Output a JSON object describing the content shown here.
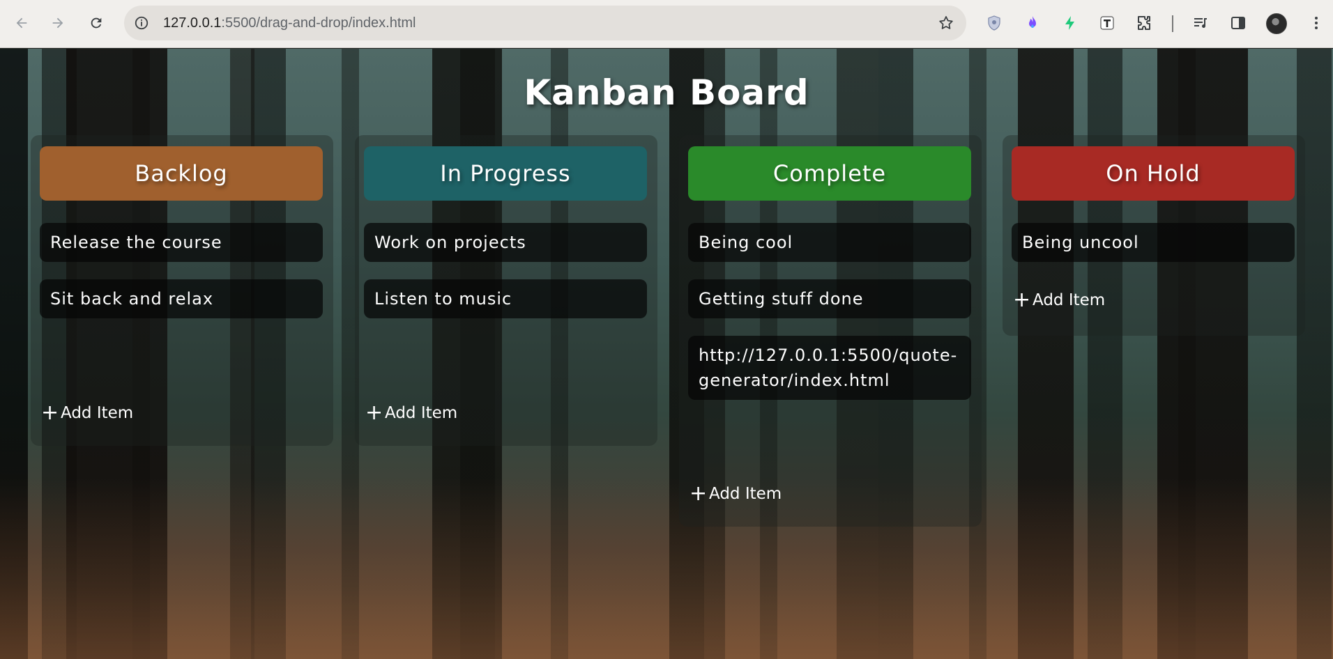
{
  "browser": {
    "url_host": "127.0.0.1",
    "url_rest": ":5500/drag-and-drop/index.html",
    "extensions": [
      "shield-extension-icon",
      "flame-extension-icon",
      "bolt-extension-icon",
      "text-extension-icon",
      "puzzle-extensions-icon",
      "media-control-icon",
      "side-panel-icon"
    ]
  },
  "board": {
    "title": "Kanban Board",
    "add_item_label": "Add Item",
    "columns": [
      {
        "title": "Backlog",
        "color": "#a0602e",
        "items": [
          "Release the course",
          "Sit back and relax"
        ]
      },
      {
        "title": "In Progress",
        "color": "#1e6266",
        "items": [
          "Work on projects",
          "Listen to music"
        ]
      },
      {
        "title": "Complete",
        "color": "#2a8a2a",
        "items": [
          "Being cool",
          "Getting stuff done",
          "http://127.0.0.1:5500/quote-generator/index.html"
        ]
      },
      {
        "title": "On Hold",
        "color": "#a82a24",
        "items": [
          "Being uncool"
        ]
      }
    ]
  }
}
